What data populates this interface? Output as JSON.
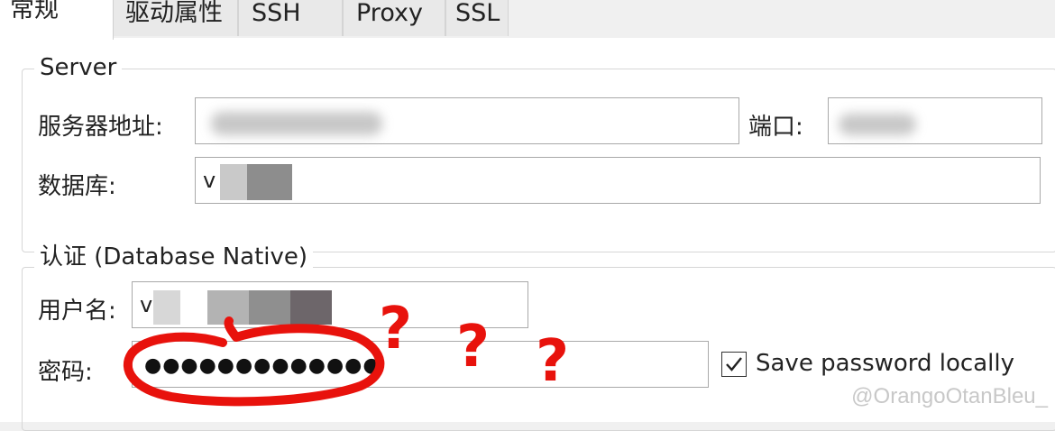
{
  "tabs": [
    {
      "label": "常规",
      "active": true
    },
    {
      "label": "驱动属性",
      "active": false
    },
    {
      "label": "SSH",
      "active": false
    },
    {
      "label": "Proxy",
      "active": false
    },
    {
      "label": "SSL",
      "active": false
    }
  ],
  "server": {
    "legend": "Server",
    "host_label": "服务器地址:",
    "host_value": "",
    "port_label": "端口:",
    "port_value": "",
    "database_label": "数据库:",
    "database_value": "v"
  },
  "auth": {
    "legend": "认证 (Database Native)",
    "username_label": "用户名:",
    "username_value": "v",
    "password_label": "密码:",
    "password_value": "●●●●●●●●●●●●●",
    "save_password_label": "Save password locally",
    "save_password_checked": true
  },
  "annotation": {
    "marks": [
      "?",
      "?",
      "?"
    ],
    "color": "#e8120c"
  },
  "watermark": "@OrangoOtanBleu_"
}
